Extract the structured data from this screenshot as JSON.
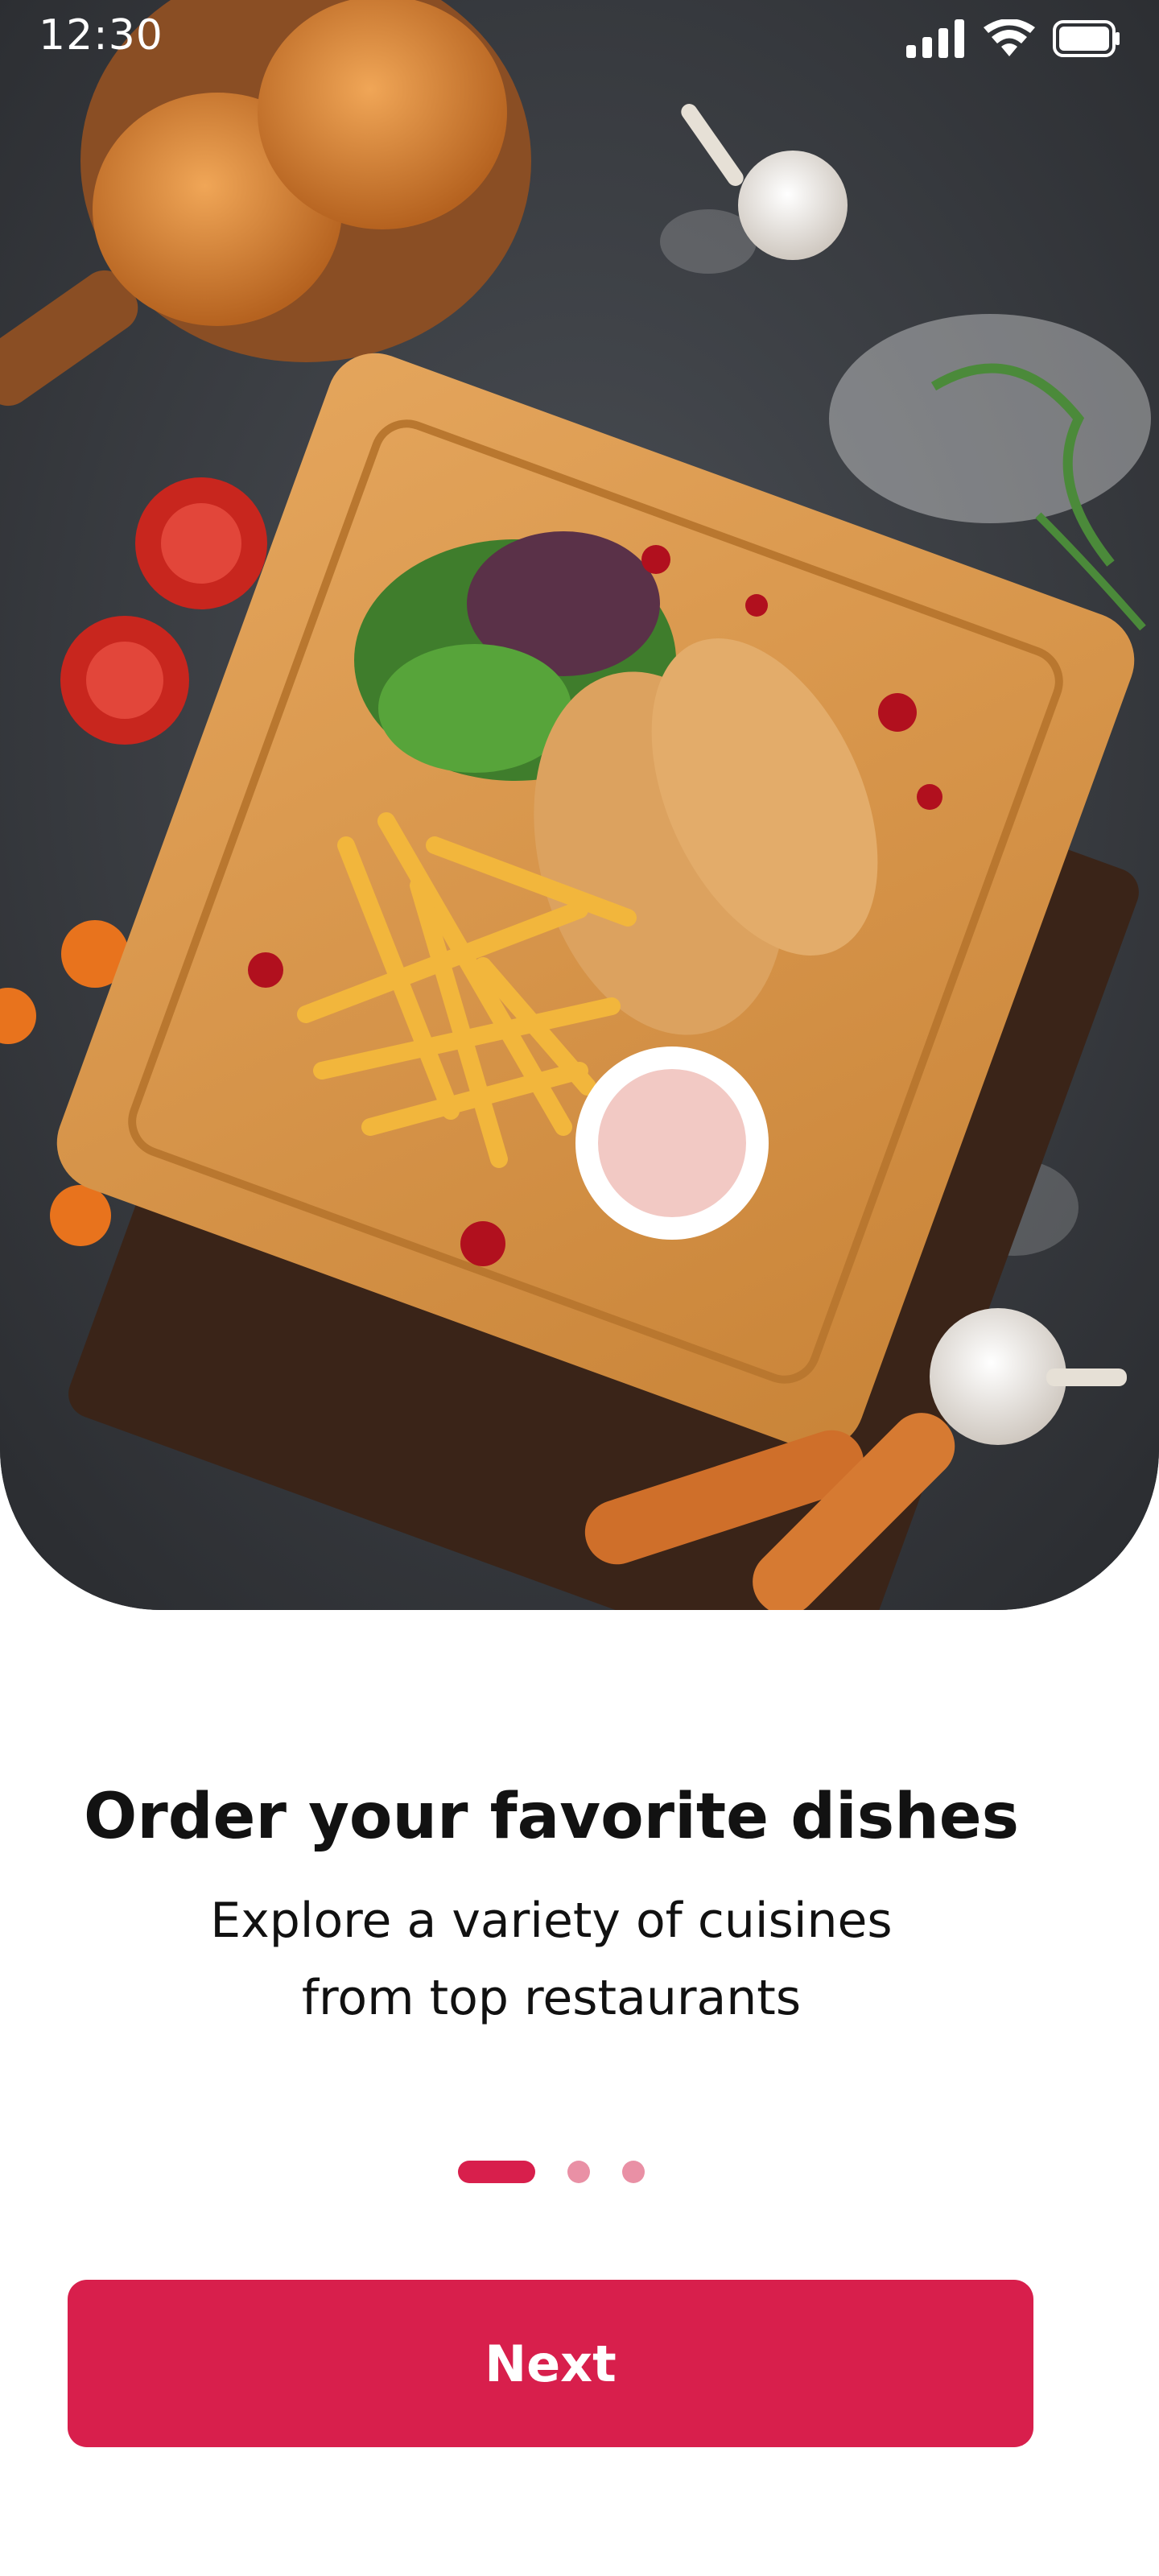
{
  "status_bar": {
    "time": "12:30",
    "icons": [
      "signal-icon",
      "wifi-icon",
      "battery-icon"
    ]
  },
  "hero": {
    "image": "food-board-illustration"
  },
  "onboarding": {
    "title": "Order your favorite dishes",
    "subtitle_line1": "Explore a variety of cuisines",
    "subtitle_line2": "from top restaurants"
  },
  "pagination": {
    "total": 3,
    "active": 1
  },
  "actions": {
    "next_label": "Next"
  },
  "colors": {
    "accent": "#d81f4c",
    "dot_inactive": "#e990a5",
    "text": "#121212",
    "background": "#ffffff"
  }
}
